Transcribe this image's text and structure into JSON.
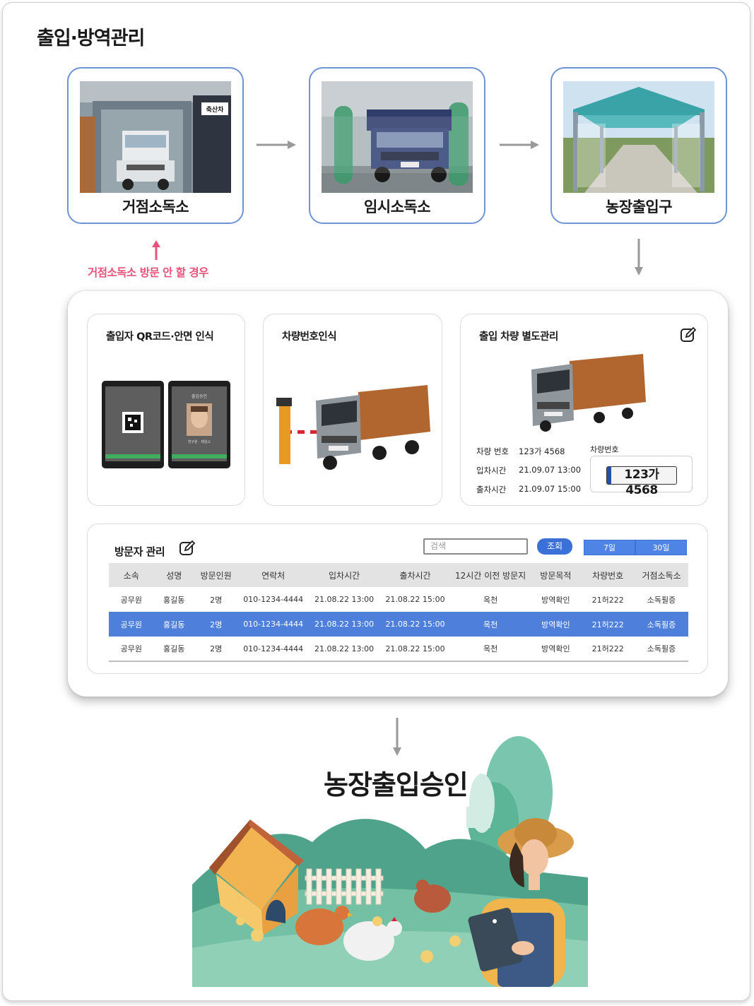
{
  "page": {
    "title": "출입·방역관리"
  },
  "flow": {
    "stages": [
      {
        "label": "거점소독소",
        "sign_text": "축산차"
      },
      {
        "label": "임시소독소"
      },
      {
        "label": "농장출입구"
      }
    ],
    "note": "거점소독소 방문 안 할 경우"
  },
  "cards": {
    "qr": {
      "title": "출입자 QR코드·안면 인식",
      "tablet_header": "출입승인",
      "tablet_caption": "연구원 · 제임스"
    },
    "plate_recognition": {
      "title": "차량번호인식"
    },
    "vehicle_mgmt": {
      "title": "출입 차량 별도관리",
      "rows": [
        {
          "label": "차량 번호",
          "value": "123가 4568"
        },
        {
          "label": "입차시간",
          "value": "21.09.07 13:00"
        },
        {
          "label": "출차시간",
          "value": "21.09.07 15:00"
        }
      ],
      "plate_label": "차량번호",
      "plate_value": "123가 4568"
    }
  },
  "visitors": {
    "title": "방문자 관리",
    "search_placeholder": "검색",
    "query_button": "조회",
    "range_buttons": [
      "7일",
      "30일"
    ],
    "columns": [
      "소속",
      "성명",
      "방문인원",
      "연락처",
      "입차시간",
      "출차시간",
      "12시간 이전 방문지",
      "방문목적",
      "차량번호",
      "거점소독소"
    ],
    "rows": [
      [
        "공무원",
        "홍길동",
        "2명",
        "010-1234-4444",
        "21.08.22 13:00",
        "21.08.22 15:00",
        "옥천",
        "방역확인",
        "21허222",
        "소독필증"
      ],
      [
        "공무원",
        "홍길동",
        "2명",
        "010-1234-4444",
        "21.08.22 13:00",
        "21.08.22 15:00",
        "옥천",
        "방역확인",
        "21허222",
        "소독필증"
      ],
      [
        "공무원",
        "홍길동",
        "2명",
        "010-1234-4444",
        "21.08.22 13:00",
        "21.08.22 15:00",
        "옥천",
        "방역확인",
        "21허222",
        "소독필증"
      ]
    ],
    "selected_row": 1
  },
  "final": {
    "title": "농장출입승인"
  },
  "colors": {
    "accent": "#4d7fdb",
    "stage_border": "#6f93d4",
    "note": "#e8537b"
  }
}
